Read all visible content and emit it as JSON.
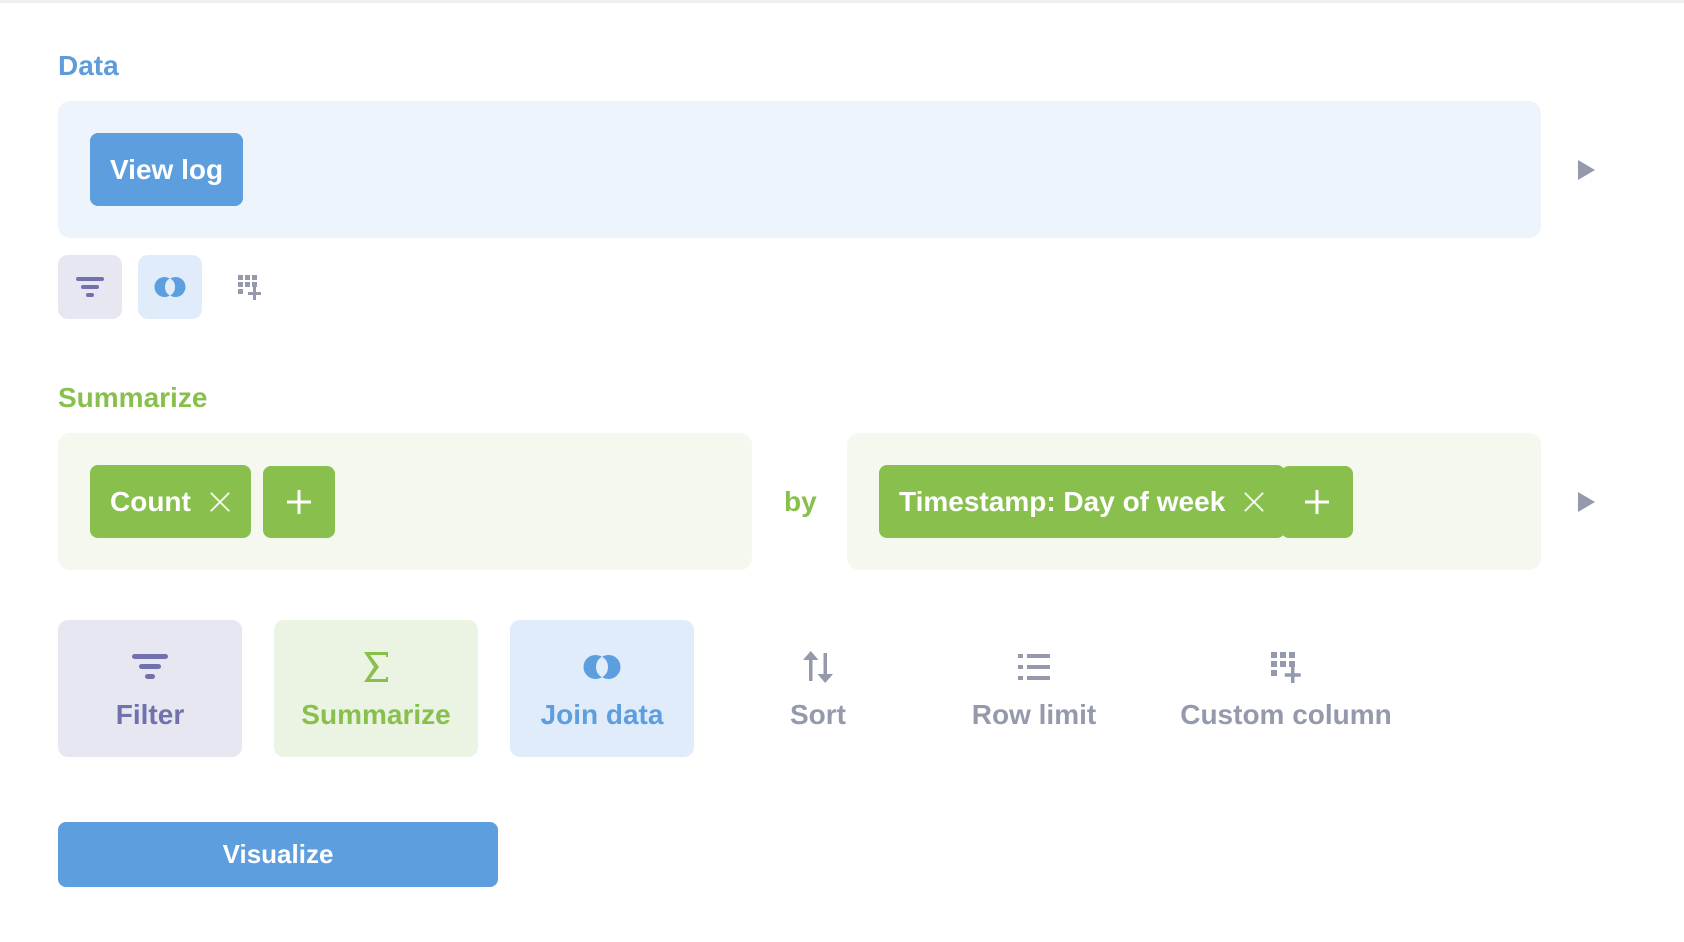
{
  "data_section": {
    "title": "Data",
    "source_label": "View log"
  },
  "summarize_section": {
    "title": "Summarize",
    "metric_label": "Count",
    "by_label": "by",
    "group_label": "Timestamp: Day of week"
  },
  "steps": {
    "filter_label": "Filter",
    "summarize_label": "Summarize",
    "join_label": "Join data",
    "sort_label": "Sort",
    "row_limit_label": "Row limit",
    "custom_column_label": "Custom column"
  },
  "visualize_label": "Visualize",
  "colors": {
    "data_blue": "#5c9ede",
    "summarize_green": "#88bf4d",
    "filter_purple": "#7172ad",
    "muted_gray": "#949aab"
  }
}
